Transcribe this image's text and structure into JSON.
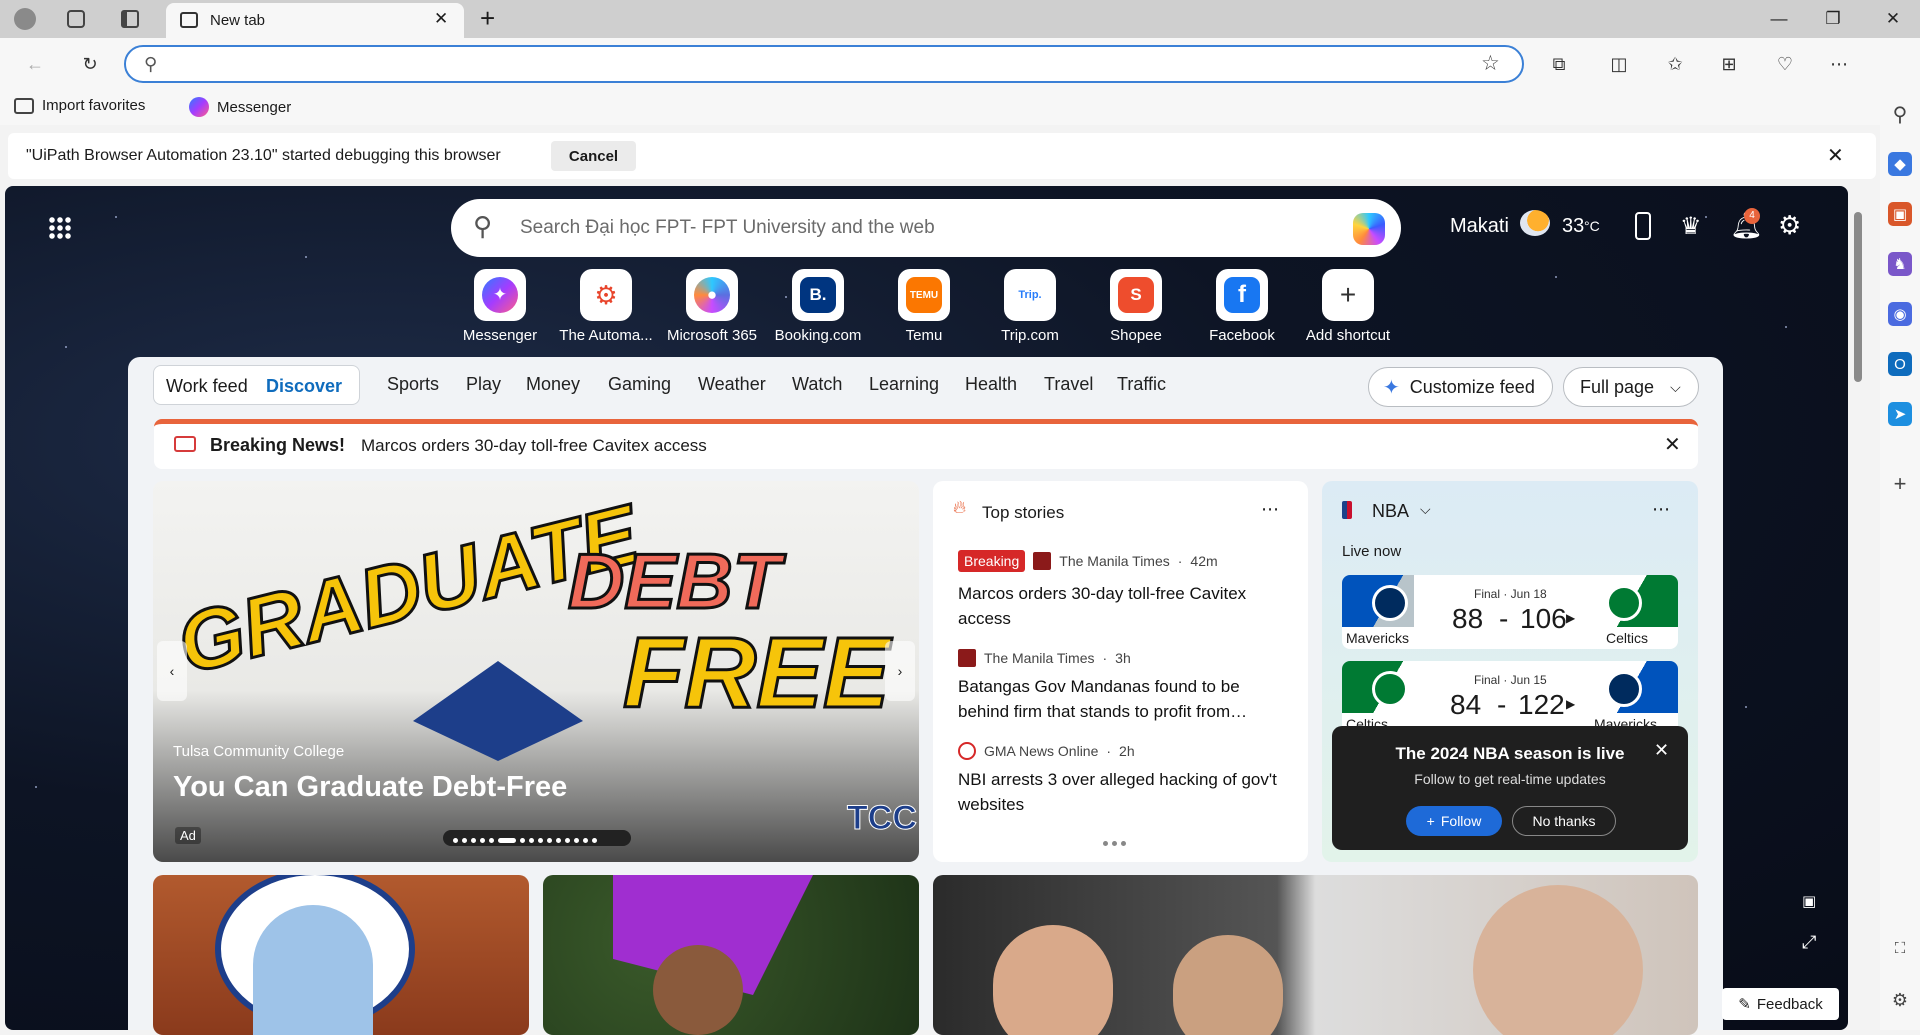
{
  "browser": {
    "tab_title": "New tab",
    "address_value": "",
    "favorites": [
      {
        "label": "Import favorites"
      },
      {
        "label": "Messenger"
      }
    ],
    "infobar": {
      "message": "\"UiPath Browser Automation 23.10\" started debugging this browser",
      "cancel_label": "Cancel"
    }
  },
  "ntp": {
    "search_placeholder": "Search Đại học FPT- FPT University and the web",
    "weather": {
      "city": "Makati",
      "temp": "33",
      "unit": "°C"
    },
    "notification_count": "4",
    "shortcuts": [
      {
        "label": "Messenger",
        "color": "#7b4dff"
      },
      {
        "label": "The Automa...",
        "color": "#e8452c"
      },
      {
        "label": "Microsoft 365",
        "color": "#5b6fe0"
      },
      {
        "label": "Booking.com",
        "color": "#003580"
      },
      {
        "label": "Temu",
        "color": "#fb7701"
      },
      {
        "label": "Trip.com",
        "color": "#287dfa"
      },
      {
        "label": "Shopee",
        "color": "#ee4d2d"
      },
      {
        "label": "Facebook",
        "color": "#1877f2"
      },
      {
        "label": "Add shortcut",
        "color": "#ffffff"
      }
    ],
    "feed_tabs": {
      "work_feed": "Work feed",
      "discover": "Discover",
      "categories": [
        "Sports",
        "Play",
        "Money",
        "Gaming",
        "Weather",
        "Watch",
        "Learning",
        "Health",
        "Travel",
        "Traffic"
      ]
    },
    "customize_label": "Customize feed",
    "layout_label": "Full page",
    "breaking": {
      "label": "Breaking News!",
      "headline": "Marcos orders 30-day toll-free Cavitex access"
    },
    "hero": {
      "source": "Tulsa Community College",
      "headline": "You Can Graduate Debt-Free",
      "ad_label": "Ad",
      "art_word_1": "GRADUATE",
      "art_word_2": "DEBT",
      "art_word_3": "FREE",
      "logo_text": "TCC"
    },
    "top_stories": {
      "title": "Top stories",
      "items": [
        {
          "badge": "Breaking",
          "source": "The Manila Times",
          "time": "42m",
          "headline": "Marcos orders 30-day toll-free Cavitex access"
        },
        {
          "badge": "",
          "source": "The Manila Times",
          "time": "3h",
          "headline": "Batangas Gov Mandanas found to be behind firm that stands to profit from…"
        },
        {
          "badge": "",
          "source": "GMA News Online",
          "time": "2h",
          "headline": "NBI arrests 3 over alleged hacking of gov't websites"
        }
      ]
    },
    "nba": {
      "title": "NBA",
      "live_label": "Live now",
      "games": [
        {
          "status": "Final · Jun 18",
          "score_left": "88",
          "score_right": "106",
          "team_left": "Mavericks",
          "team_right": "Celtics"
        },
        {
          "status": "Final · Jun 15",
          "score_left": "84",
          "score_right": "122",
          "team_left": "Celtics",
          "team_right": "Mavericks"
        }
      ],
      "popup": {
        "title": "The 2024 NBA season is live",
        "subtitle": "Follow to get real-time updates",
        "follow_label": "Follow",
        "decline_label": "No thanks"
      }
    },
    "feedback_label": "Feedback"
  }
}
